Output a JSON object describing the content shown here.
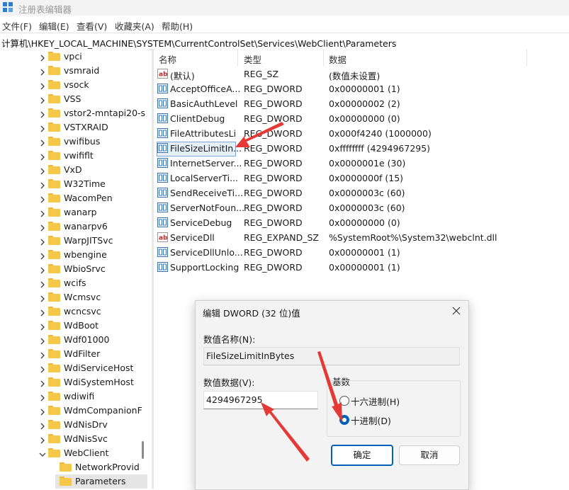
{
  "window": {
    "title": "注册表编辑器"
  },
  "menu": [
    "文件(F)",
    "编辑(E)",
    "查看(V)",
    "收藏夹(A)",
    "帮助(H)"
  ],
  "address": "计算机\\HKEY_LOCAL_MACHINE\\SYSTEM\\CurrentControlSet\\Services\\WebClient\\Parameters",
  "tree": {
    "items": [
      {
        "label": "vpci"
      },
      {
        "label": "vsmraid"
      },
      {
        "label": "vsock"
      },
      {
        "label": "VSS"
      },
      {
        "label": "vstor2-mntapi20-s"
      },
      {
        "label": "VSTXRAID"
      },
      {
        "label": "vwifibus"
      },
      {
        "label": "vwififlt"
      },
      {
        "label": "VxD"
      },
      {
        "label": "W32Time"
      },
      {
        "label": "WacomPen"
      },
      {
        "label": "wanarp"
      },
      {
        "label": "wanarpv6"
      },
      {
        "label": "WarpJITSvc"
      },
      {
        "label": "wbengine"
      },
      {
        "label": "WbioSrvc"
      },
      {
        "label": "wcifs"
      },
      {
        "label": "Wcmsvc"
      },
      {
        "label": "wcncsvc"
      },
      {
        "label": "WdBoot"
      },
      {
        "label": "Wdf01000"
      },
      {
        "label": "WdFilter"
      },
      {
        "label": "WdiServiceHost"
      },
      {
        "label": "WdiSystemHost"
      },
      {
        "label": "wdiwifi"
      },
      {
        "label": "WdmCompanionF"
      },
      {
        "label": "WdNisDrv"
      },
      {
        "label": "WdNisSvc"
      },
      {
        "label": "WebClient"
      }
    ],
    "children": [
      {
        "label": "NetworkProvid"
      },
      {
        "label": "Parameters"
      }
    ]
  },
  "list": {
    "columns": [
      "名称",
      "类型",
      "数据"
    ],
    "rows": [
      {
        "name": "(默认)",
        "type": "REG_SZ",
        "data": "(数值未设置)",
        "icon": "string-value-icon"
      },
      {
        "name": "AcceptOfficeA...",
        "type": "REG_DWORD",
        "data": "0x00000001 (1)",
        "icon": "binary-value-icon"
      },
      {
        "name": "BasicAuthLevel",
        "type": "REG_DWORD",
        "data": "0x00000002 (2)",
        "icon": "binary-value-icon"
      },
      {
        "name": "ClientDebug",
        "type": "REG_DWORD",
        "data": "0x00000000 (0)",
        "icon": "binary-value-icon"
      },
      {
        "name": "FileAttributesLi",
        "type": "REG_DWORD",
        "data": "0x000f4240 (1000000)",
        "icon": "binary-value-icon"
      },
      {
        "name": "FileSizeLimitIn...",
        "type": "REG_DWORD",
        "data": "0xffffffff (4294967295)",
        "icon": "binary-value-icon"
      },
      {
        "name": "InternetServer...",
        "type": "REG_DWORD",
        "data": "0x0000001e (30)",
        "icon": "binary-value-icon"
      },
      {
        "name": "LocalServerTi...",
        "type": "REG_DWORD",
        "data": "0x0000000f (15)",
        "icon": "binary-value-icon"
      },
      {
        "name": "SendReceiveTi...",
        "type": "REG_DWORD",
        "data": "0x0000003c (60)",
        "icon": "binary-value-icon"
      },
      {
        "name": "ServerNotFoun...",
        "type": "REG_DWORD",
        "data": "0x0000003c (60)",
        "icon": "binary-value-icon"
      },
      {
        "name": "ServiceDebug",
        "type": "REG_DWORD",
        "data": "0x00000000 (0)",
        "icon": "binary-value-icon"
      },
      {
        "name": "ServiceDll",
        "type": "REG_EXPAND_SZ",
        "data": "%SystemRoot%\\System32\\webclnt.dll",
        "icon": "string-value-icon"
      },
      {
        "name": "ServiceDllUnlo...",
        "type": "REG_DWORD",
        "data": "0x00000001 (1)",
        "icon": "binary-value-icon"
      },
      {
        "name": "SupportLocking",
        "type": "REG_DWORD",
        "data": "0x00000001 (1)",
        "icon": "binary-value-icon"
      }
    ]
  },
  "dialog": {
    "title": "编辑 DWORD (32 位)值",
    "value_name_label": "数值名称(N):",
    "value_name": "FileSizeLimitInBytes",
    "value_data_label": "数值数据(V):",
    "value_data": "4294967295",
    "base_label": "基数",
    "radio_hex": "十六进制(H)",
    "radio_dec": "十进制(D)",
    "selected_base": "dec",
    "ok": "确定",
    "cancel": "取消"
  },
  "colors": {
    "accent": "#005fb8",
    "folder": "#f5c84a",
    "arrow": "#e53935"
  }
}
